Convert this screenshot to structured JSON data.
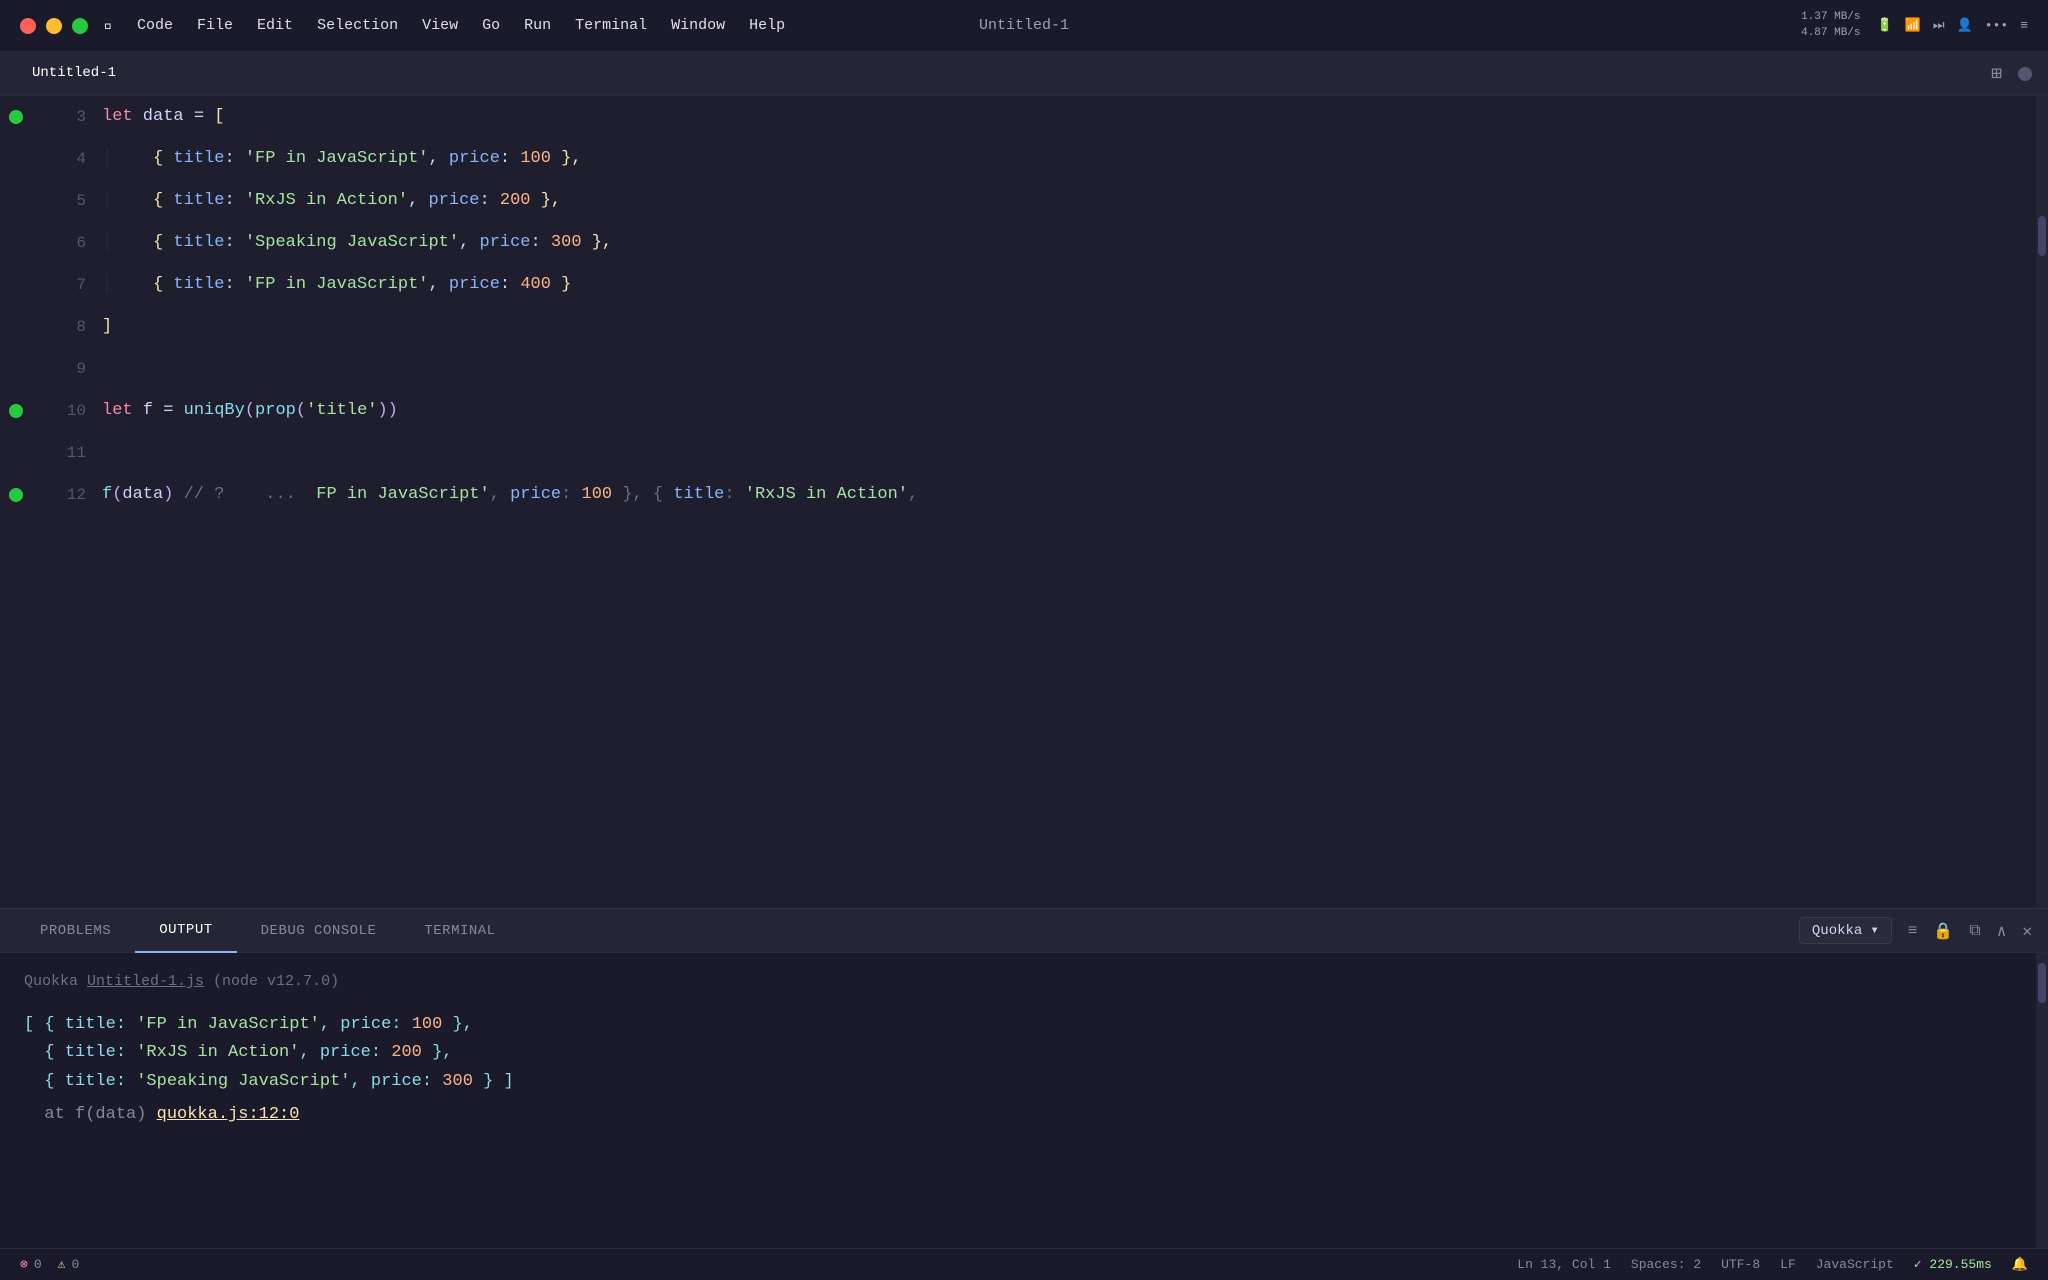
{
  "titleBar": {
    "title": "Untitled-1",
    "menuItems": [
      "Apple",
      "Code",
      "File",
      "Edit",
      "Selection",
      "View",
      "Go",
      "Run",
      "Terminal",
      "Window",
      "Help"
    ],
    "networkUp": "1.37 MB/s",
    "networkDown": "4.87 MB/s"
  },
  "tabBar": {
    "tabName": "Untitled-1"
  },
  "editor": {
    "lines": [
      {
        "num": "3",
        "dot": true,
        "content": "let data = ["
      },
      {
        "num": "4",
        "dot": false,
        "content": "    { title: 'FP in JavaScript', price: 100 },"
      },
      {
        "num": "5",
        "dot": false,
        "content": "    { title: 'RxJS in Action', price: 200 },"
      },
      {
        "num": "6",
        "dot": false,
        "content": "    { title: 'Speaking JavaScript', price: 300 },"
      },
      {
        "num": "7",
        "dot": false,
        "content": "    { title: 'FP in JavaScript', price: 400 }"
      },
      {
        "num": "8",
        "dot": false,
        "content": "]"
      },
      {
        "num": "9",
        "dot": false,
        "content": ""
      },
      {
        "num": "10",
        "dot": true,
        "content": "let f = uniqBy(prop('title'))"
      },
      {
        "num": "11",
        "dot": false,
        "content": ""
      },
      {
        "num": "12",
        "dot": true,
        "content": "f(data) // ?    ...  FP in JavaScript', price: 100 }, { title: 'RxJS in Action', p"
      }
    ]
  },
  "panel": {
    "tabs": [
      "PROBLEMS",
      "OUTPUT",
      "DEBUG CONSOLE",
      "TERMINAL"
    ],
    "activeTab": "OUTPUT",
    "quokkaLabel": "Quokka",
    "outputHeader": "Quokka  Untitled-1.js  (node v12.7.0)",
    "outputLines": [
      "[ { title: 'FP in JavaScript', price: 100 },",
      "  { title: 'RxJS in Action', price: 200 },",
      "  { title: 'Speaking JavaScript', price: 300 } ]",
      "  at f(data) quokka.js:12:0"
    ],
    "outputLink": "quokka.js:12:0"
  },
  "statusBar": {
    "errors": "0",
    "warnings": "0",
    "position": "Ln 13, Col 1",
    "spaces": "Spaces: 2",
    "encoding": "UTF-8",
    "lineEnding": "LF",
    "language": "JavaScript",
    "timing": "✓ 229.55ms"
  }
}
